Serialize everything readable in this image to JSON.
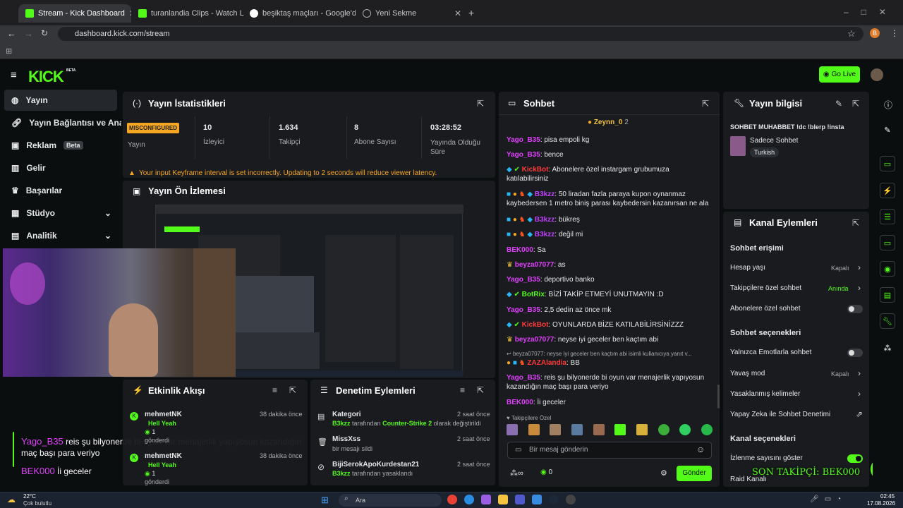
{
  "browser": {
    "tabs": [
      {
        "title": "Stream - Kick Dashboard",
        "active": true
      },
      {
        "title": "turanlandia Clips - Watch Live o",
        "active": false
      },
      {
        "title": "beşiktaş maçları - Google'da Ar",
        "active": false
      },
      {
        "title": "Yeni Sekme",
        "active": false
      }
    ],
    "url": "dashboard.kick.com/stream",
    "profile_initial": "B"
  },
  "app": {
    "logo": "KICK",
    "logo_badge": "BETA",
    "go_live": "Go Live"
  },
  "sidebar": {
    "items": [
      {
        "label": "Yayın"
      },
      {
        "label": "Yayın Bağlantısı ve Anahtar"
      },
      {
        "label": "Reklam",
        "badge": "Beta"
      },
      {
        "label": "Gelir"
      },
      {
        "label": "Başarılar"
      },
      {
        "label": "Stüdyo"
      },
      {
        "label": "Analitik"
      }
    ]
  },
  "stats": {
    "title": "Yayın İstatistikleri",
    "status_badge": "MISCONFIGURED",
    "status_label": "Yayın",
    "viewers": "10",
    "viewers_label": "İzleyici",
    "followers": "1.634",
    "followers_label": "Takipçi",
    "subs": "8",
    "subs_label": "Abone Sayısı",
    "duration": "03:28:52",
    "duration_label": "Yayında Olduğu Süre",
    "warning": "Your input Keyframe interval is set incorrectly. Updating to 2 seconds will reduce viewer latency."
  },
  "preview": {
    "title": "Yayın Ön İzlemesi"
  },
  "overlay": {
    "line1_user": "Yago_B35",
    "line1_text": "reis şu bilyonerde bi oyun var menajerlik yapıyosun kazandığın maç başı para veriyo",
    "line2_user": "BEK000",
    "line2_text": "İi geceler",
    "ticker": "SON TAKİPÇİ: BEK000"
  },
  "activity": {
    "title": "Etkinlik Akışı",
    "items": [
      {
        "user": "mehmetNK",
        "time": "38 dakika önce",
        "msg": "Hell Yeah",
        "count": "1",
        "action": "gönderdi"
      },
      {
        "user": "mehmetNK",
        "time": "38 dakika önce",
        "msg": "Hell Yeah",
        "count": "1",
        "action": "gönderdi"
      }
    ]
  },
  "moderation": {
    "title": "Denetim Eylemleri",
    "items": [
      {
        "title": "Kategori",
        "time": "2 saat önce",
        "actor": "B3kzz",
        "mid": "tarafından",
        "target": "Counter-Strike 2",
        "tail": "olarak değiştirildi"
      },
      {
        "title": "MissXss",
        "time": "2 saat önce",
        "sub": "bir mesajı sildi"
      },
      {
        "title": "BijiSerokApoKurdestan21",
        "time": "2 saat önce",
        "actor": "B3kzz",
        "tail": "tarafından yasaklandı"
      }
    ]
  },
  "chat": {
    "title": "Sohbet",
    "pinned_user": "Zeynn_0",
    "pinned_count": "2",
    "messages": [
      {
        "user": "Yago_B35",
        "text": "pisa empoli kg",
        "color": "#e040fb"
      },
      {
        "user": "Yago_B35",
        "text": "bence",
        "color": "#e040fb"
      },
      {
        "user": "KickBot",
        "text": "Abonelere özel instargam grubumuza katılabilirsiniz",
        "color": "#ff3b3b"
      },
      {
        "user": "B3kzz",
        "text": "50 liradan fazla paraya kupon oynanmaz kaybedersen 1 metro biniş parası kaybedersin kazanırsan ne ala",
        "color": "#c040ff"
      },
      {
        "user": "B3kzz",
        "text": "bükreş",
        "color": "#c040ff"
      },
      {
        "user": "B3kzz",
        "text": "değil mi",
        "color": "#c040ff"
      },
      {
        "user": "BEK000",
        "text": "Sa",
        "color": "#e040fb"
      },
      {
        "user": "beyza07077",
        "text": "as",
        "color": "#e040fb"
      },
      {
        "user": "Yago_B35",
        "text": "deportivo banko",
        "color": "#e040fb"
      },
      {
        "user": "BotRix",
        "text": "BİZİ TAKİP ETMEYİ UNUTMAYIN :D",
        "color": "#53fc18"
      },
      {
        "user": "Yago_B35",
        "text": "2,5 dedin az önce mk",
        "color": "#e040fb"
      },
      {
        "user": "KickBot",
        "text": "OYUNLARDA BİZE KATILABİLİRSİNİZZZ",
        "color": "#ff3b3b"
      },
      {
        "user": "beyza07077",
        "text": "neyse iyi geceler ben kaçtım abi",
        "color": "#e040fb"
      },
      {
        "user": "ZAZAlandia",
        "text": "BB",
        "color": "#ff3b3b",
        "reply": "beyza07077: neyse iyi geceler ben kaçtım abi isimli kullanıcıya yanıt v..."
      },
      {
        "user": "Yago_B35",
        "text": "reis şu bilyonerde bi oyun var menajerlik yapıyosun kazandığın maç başı para veriyo",
        "color": "#e040fb"
      },
      {
        "user": "BEK000",
        "text": "İi geceler",
        "color": "#e040fb"
      }
    ],
    "emote_label": "Takipçilere Özel",
    "input_placeholder": "Bir mesaj gönderin",
    "points": "0",
    "send": "Gönder"
  },
  "info": {
    "title": "Yayın bilgisi",
    "stream_title": "SOHBET MUHABBET !dc !blerp !insta",
    "category": "Sadece Sohbet",
    "language": "Turkish"
  },
  "channel": {
    "title": "Kanal Eylemleri",
    "access_title": "Sohbet erişimi",
    "rows": [
      {
        "label": "Hesap yaşı",
        "value": "Kapalı"
      },
      {
        "label": "Takipçilere özel sohbet",
        "value": "Anında"
      },
      {
        "label": "Abonelere özel sohbet",
        "toggle": false
      }
    ],
    "options_title": "Sohbet seçenekleri",
    "options": [
      {
        "label": "Yalnızca Emotlarla sohbet",
        "toggle": false
      },
      {
        "label": "Yavaş mod",
        "value": "Kapalı"
      },
      {
        "label": "Yasaklanmış kelimeler"
      },
      {
        "label": "Yapay Zeka ile Sohbet Denetimi"
      }
    ],
    "channel_title": "Kanal seçenekleri",
    "channel_opts": [
      {
        "label": "İzlenme sayısını göster",
        "toggle": true
      },
      {
        "label": "Raid Kanalı"
      }
    ]
  },
  "taskbar": {
    "temp": "22°C",
    "weather": "Çok bulutlu",
    "search": "Ara",
    "time": "02:45",
    "date": "17.08.2026"
  }
}
